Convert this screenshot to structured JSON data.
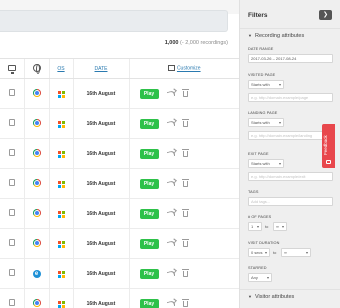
{
  "recordings": {
    "count_total": "1,000",
    "count_suffix": "(- 2,000 recordings)",
    "columns": {
      "os": "OS",
      "date": "DATE",
      "customize": "Customize"
    },
    "rows": [
      {
        "browser": "chrome",
        "os": "windows",
        "date": "16th August",
        "play_label": "Play"
      },
      {
        "browser": "chrome",
        "os": "windows",
        "date": "16th August",
        "play_label": "Play"
      },
      {
        "browser": "chrome",
        "os": "windows",
        "date": "16th August",
        "play_label": "Play"
      },
      {
        "browser": "chrome",
        "os": "windows",
        "date": "16th August",
        "play_label": "Play"
      },
      {
        "browser": "chrome",
        "os": "windows",
        "date": "16th August",
        "play_label": "Play"
      },
      {
        "browser": "chrome",
        "os": "windows",
        "date": "16th August",
        "play_label": "Play"
      },
      {
        "browser": "internet-explorer",
        "os": "windows",
        "date": "16th August",
        "play_label": "Play"
      },
      {
        "browser": "chrome",
        "os": "windows",
        "date": "16th August",
        "play_label": "Play"
      }
    ]
  },
  "filters": {
    "title": "Filters",
    "close_icon": "chevron-right-icon",
    "recording_section": "Recording attributes",
    "date_range_label": "Date range",
    "date_range_value": "2017-03-26 – 2017-08-24",
    "visited_page_label": "Visited page",
    "visited_page_match": "Starts with",
    "visited_page_placeholder": "e.g. http://domain.example/page",
    "landing_page_label": "Landing page",
    "landing_page_match": "Starts with",
    "landing_page_placeholder": "e.g. http://domain.example/landing",
    "exit_page_label": "Exit page",
    "exit_page_match": "Starts with",
    "exit_page_placeholder": "e.g. http://domain.example/exit",
    "tags_label": "Tags",
    "tags_placeholder": "Add tags...",
    "num_pages_label": "# of pages",
    "num_pages_min": "1",
    "num_pages_to": "to",
    "num_pages_max": "∞",
    "duration_label": "Visit duration",
    "duration_min": "0 secs",
    "duration_to": "to",
    "duration_max": "∞",
    "starred_label": "Starred",
    "starred_value": "Any",
    "visitor_section": "Visitor attributes"
  },
  "feedback": {
    "label": "Feedback"
  },
  "colors": {
    "play": "#2ec14a",
    "feedback": "#e8474c",
    "link": "#2a7ab0"
  }
}
